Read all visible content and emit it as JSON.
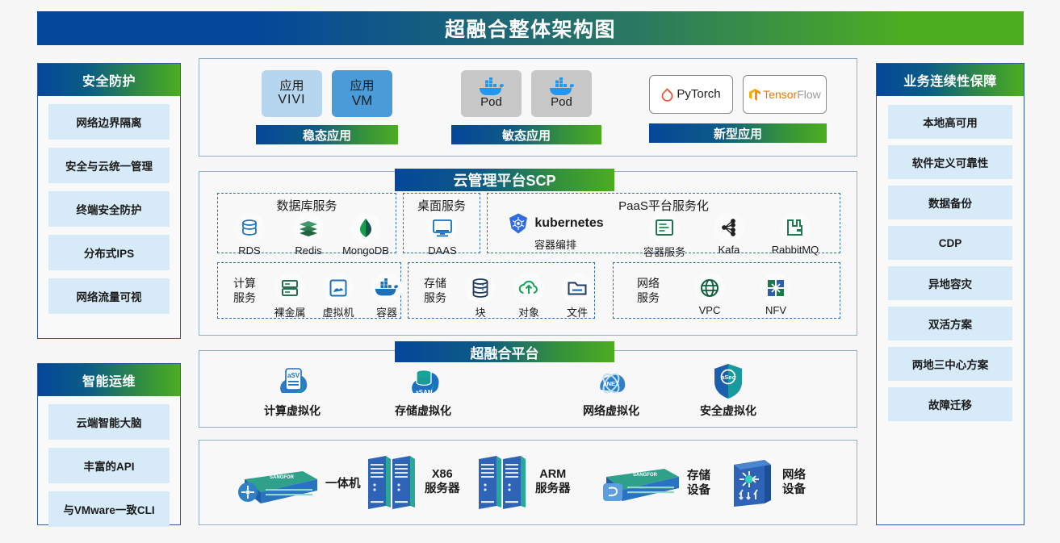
{
  "title": "超融合整体架构图",
  "left_columns": [
    {
      "header": "安全防护",
      "items": [
        "网络边界隔离",
        "安全与云统一管理",
        "终端安全防护",
        "分布式IPS",
        "网络流量可视"
      ]
    },
    {
      "header": "智能运维",
      "items": [
        "云端智能大脑",
        "丰富的API",
        "与VMware一致CLI"
      ]
    }
  ],
  "right_column": {
    "header": "业务连续性保障",
    "items": [
      "本地高可用",
      "软件定义可靠性",
      "数据备份",
      "CDP",
      "异地容灾",
      "双活方案",
      "两地三中心方案",
      "故障迁移"
    ]
  },
  "applications": {
    "groups": [
      {
        "band": "稳态应用",
        "tiles": [
          {
            "top": "应用",
            "bottom": "VIVI",
            "style": "light"
          },
          {
            "top": "应用",
            "bottom": "VM",
            "style": "blue"
          }
        ]
      },
      {
        "band": "敏态应用",
        "tiles": [
          {
            "top": "",
            "bottom": "Pod",
            "style": "gray",
            "icon": "docker-whale-icon"
          },
          {
            "top": "",
            "bottom": "Pod",
            "style": "gray",
            "icon": "docker-whale-icon"
          }
        ]
      },
      {
        "band": "新型应用",
        "tiles": [
          {
            "top": "",
            "bottom": "PyTorch",
            "style": "white",
            "icon": "pytorch-logo-icon"
          },
          {
            "top": "",
            "bottom": "TensorFlow",
            "style": "white",
            "icon": "tensorflow-logo-icon"
          }
        ]
      }
    ]
  },
  "scp": {
    "tag": "云管理平台SCP",
    "db_service": {
      "title": "数据库服务",
      "items": [
        {
          "label": "RDS",
          "icon": "database-stack-icon"
        },
        {
          "label": "Redis",
          "icon": "redis-layers-icon"
        },
        {
          "label": "MongoDB",
          "icon": "mongodb-leaf-icon"
        }
      ]
    },
    "desktop_service": {
      "title": "桌面服务",
      "items": [
        {
          "label": "DAAS",
          "icon": "monitor-icon"
        }
      ]
    },
    "paas_service": {
      "title": "PaaS平台服务化",
      "items": [
        {
          "label": "容器编排",
          "icon": "kubernetes-logo-icon",
          "brand": "kubernetes"
        },
        {
          "label": "容器服务",
          "icon": "container-service-icon"
        },
        {
          "label": "Kafa",
          "icon": "kafka-node-icon"
        },
        {
          "label": "RabbitMQ",
          "icon": "rabbitmq-icon"
        }
      ]
    },
    "compute_service": {
      "title": "计算\n服务",
      "title_l1": "计算",
      "title_l2": "服务",
      "items": [
        {
          "label": "裸金属",
          "icon": "bare-metal-icon"
        },
        {
          "label": "虚拟机",
          "icon": "virtual-machine-icon"
        },
        {
          "label": "容器",
          "icon": "docker-whale-icon"
        }
      ]
    },
    "storage_service": {
      "title_l1": "存储",
      "title_l2": "服务",
      "items": [
        {
          "label": "块",
          "icon": "block-storage-icon"
        },
        {
          "label": "对象",
          "icon": "object-storage-cloud-icon"
        },
        {
          "label": "文件",
          "icon": "file-storage-icon"
        }
      ]
    },
    "network_service": {
      "title_l1": "网络",
      "title_l2": "服务",
      "items": [
        {
          "label": "VPC",
          "icon": "globe-icon"
        },
        {
          "label": "NFV",
          "icon": "nfv-icon"
        }
      ]
    }
  },
  "hci": {
    "tag": "超融合平台",
    "items": [
      {
        "name": "计算虚拟化",
        "badge": "aSV",
        "icon": "asv-icon"
      },
      {
        "name": "存储虚拟化",
        "badge": "aSAN",
        "icon": "asan-icon"
      },
      {
        "name": "网络虚拟化",
        "badge": "aNET",
        "icon": "anet-icon"
      },
      {
        "name": "安全虚拟化",
        "badge": "aSec",
        "icon": "asec-shield-icon"
      }
    ]
  },
  "hardware": {
    "items": [
      {
        "name_l1": "一体机",
        "name_l2": "",
        "icon": "appliance-icon",
        "brand": "SANGFOR"
      },
      {
        "name_l1": "X86",
        "name_l2": "服务器",
        "icon": "rack-server-icon"
      },
      {
        "name_l1": "ARM",
        "name_l2": "服务器",
        "icon": "rack-server-icon"
      },
      {
        "name_l1": "存储",
        "name_l2": "设备",
        "icon": "storage-appliance-icon",
        "brand": "SANGFOR"
      },
      {
        "name_l1": "网络",
        "name_l2": "设备",
        "icon": "network-switch-icon"
      }
    ]
  },
  "colors": {
    "brand_blue": "#04479a",
    "brand_green": "#4cad21",
    "item_bg": "#d6eaf8",
    "panel_border": "#2e5d96",
    "dash_border": "#2f6fb0"
  }
}
